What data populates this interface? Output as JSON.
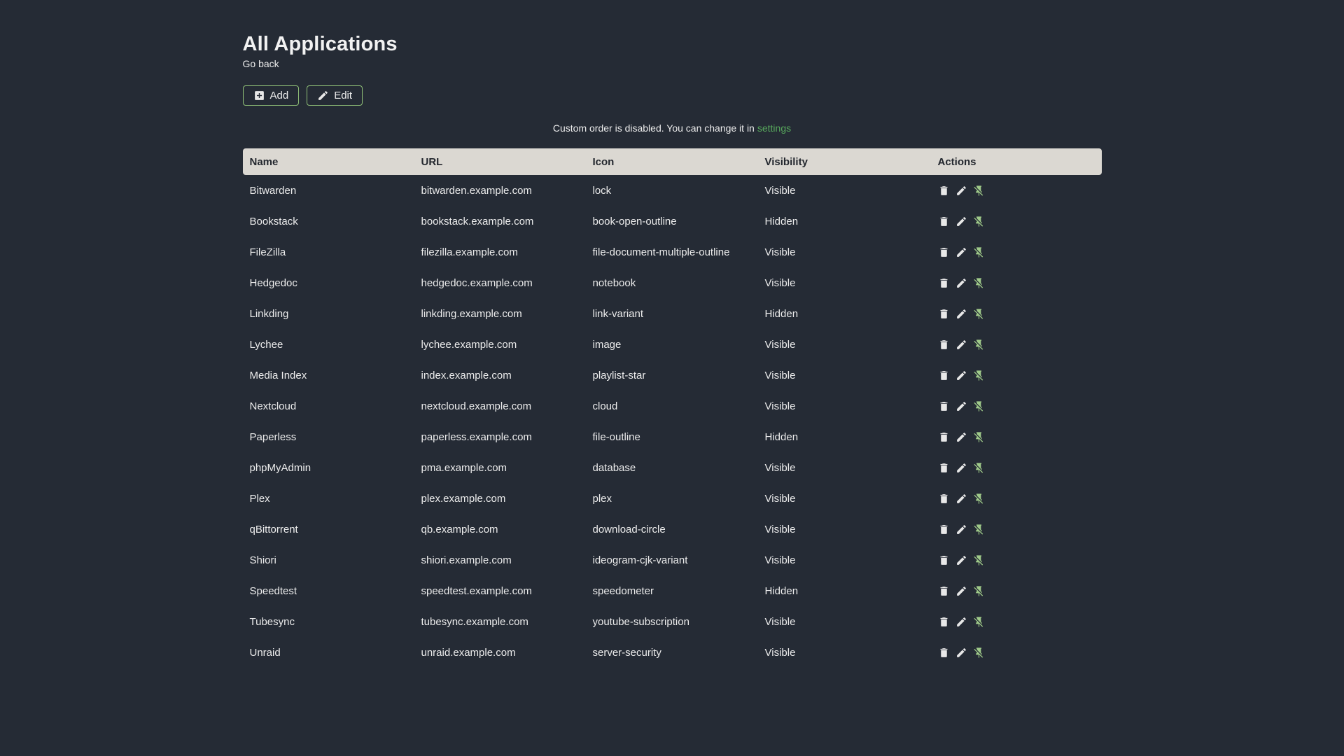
{
  "page": {
    "title": "All Applications",
    "back_link": "Go back"
  },
  "toolbar": {
    "add_label": "Add",
    "edit_label": "Edit"
  },
  "notice": {
    "text": "Custom order is disabled. You can change it in",
    "link_label": "settings"
  },
  "icons": {
    "add_button": "plus-box-icon",
    "edit_button": "pencil-icon",
    "row_actions": [
      "delete-icon",
      "pencil-icon",
      "pin-off-icon"
    ]
  },
  "colors": {
    "background": "#252b35",
    "header_bg": "#dbd8d2",
    "header_text": "#23272e",
    "text": "#ececec",
    "accent_green": "#57a85c",
    "pale_green_icon": "#a0cb8a",
    "button_border": "#8fbf77"
  },
  "table": {
    "headers": [
      "Name",
      "URL",
      "Icon",
      "Visibility",
      "Actions"
    ],
    "rows": [
      {
        "name": "Bitwarden",
        "url": "bitwarden.example.com",
        "icon": "lock",
        "visibility": "Visible"
      },
      {
        "name": "Bookstack",
        "url": "bookstack.example.com",
        "icon": "book-open-outline",
        "visibility": "Hidden"
      },
      {
        "name": "FileZilla",
        "url": "filezilla.example.com",
        "icon": "file-document-multiple-outline",
        "visibility": "Visible"
      },
      {
        "name": "Hedgedoc",
        "url": "hedgedoc.example.com",
        "icon": "notebook",
        "visibility": "Visible"
      },
      {
        "name": "Linkding",
        "url": "linkding.example.com",
        "icon": "link-variant",
        "visibility": "Hidden"
      },
      {
        "name": "Lychee",
        "url": "lychee.example.com",
        "icon": "image",
        "visibility": "Visible"
      },
      {
        "name": "Media Index",
        "url": "index.example.com",
        "icon": "playlist-star",
        "visibility": "Visible"
      },
      {
        "name": "Nextcloud",
        "url": "nextcloud.example.com",
        "icon": "cloud",
        "visibility": "Visible"
      },
      {
        "name": "Paperless",
        "url": "paperless.example.com",
        "icon": "file-outline",
        "visibility": "Hidden"
      },
      {
        "name": "phpMyAdmin",
        "url": "pma.example.com",
        "icon": "database",
        "visibility": "Visible"
      },
      {
        "name": "Plex",
        "url": "plex.example.com",
        "icon": "plex",
        "visibility": "Visible"
      },
      {
        "name": "qBittorrent",
        "url": "qb.example.com",
        "icon": "download-circle",
        "visibility": "Visible"
      },
      {
        "name": "Shiori",
        "url": "shiori.example.com",
        "icon": "ideogram-cjk-variant",
        "visibility": "Visible"
      },
      {
        "name": "Speedtest",
        "url": "speedtest.example.com",
        "icon": "speedometer",
        "visibility": "Hidden"
      },
      {
        "name": "Tubesync",
        "url": "tubesync.example.com",
        "icon": "youtube-subscription",
        "visibility": "Visible"
      },
      {
        "name": "Unraid",
        "url": "unraid.example.com",
        "icon": "server-security",
        "visibility": "Visible"
      }
    ]
  }
}
